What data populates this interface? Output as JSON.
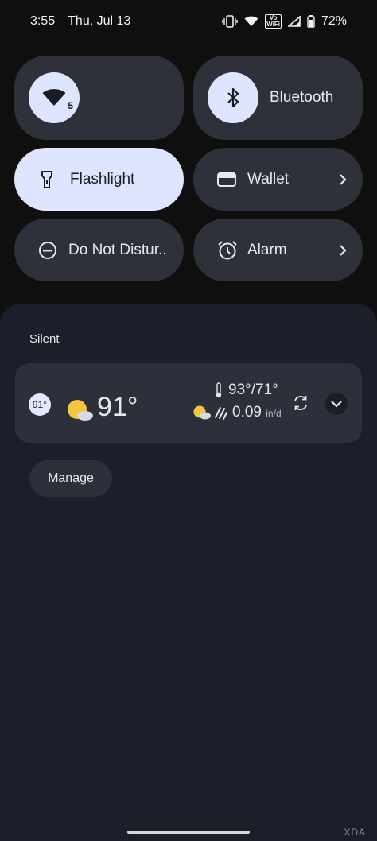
{
  "status_bar": {
    "time": "3:55",
    "date": "Thu, Jul 13",
    "vowifi_top": "Vo",
    "vowifi_bottom": "WiFi",
    "battery": "72%"
  },
  "quick_settings": {
    "wifi_badge": "5",
    "bluetooth_label": "Bluetooth",
    "flashlight_label": "Flashlight",
    "wallet_label": "Wallet",
    "dnd_label": "Do Not Distur..",
    "alarm_label": "Alarm"
  },
  "notifications": {
    "section_label": "Silent",
    "weather": {
      "badge": "91°",
      "current_temp": "91°",
      "hi_lo": "93°/71°",
      "precip": "0.09",
      "precip_unit": "in/d"
    },
    "manage_label": "Manage"
  },
  "watermark": "XDA",
  "colors": {
    "tile_active": "#dfe5ff",
    "tile_inactive": "#2e303a",
    "shade_bg": "#1b1f2a",
    "card_bg": "#2d303b"
  }
}
